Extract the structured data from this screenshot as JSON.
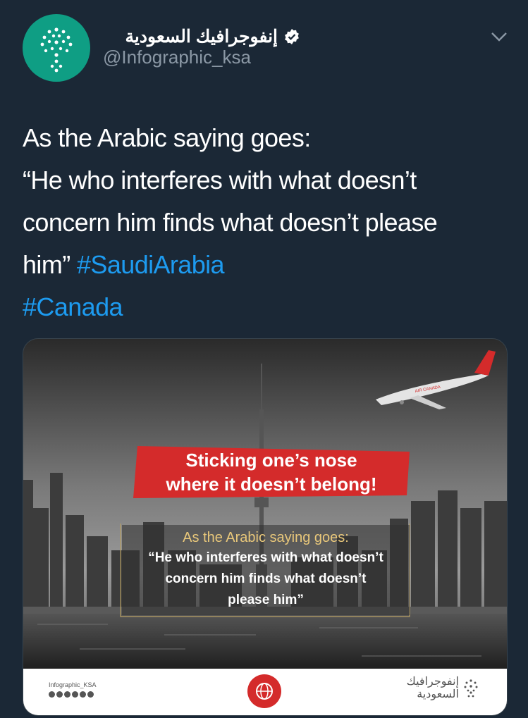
{
  "account": {
    "display_name": "إنفوجرافيك السعودية",
    "handle": "@Infographic_ksa",
    "verified": true,
    "avatar_icon": "infographic-logo-icon",
    "avatar_color": "#0f9e84"
  },
  "menu": {
    "icon": "chevron-down-icon"
  },
  "tweet": {
    "line1": "As the Arabic saying goes:",
    "line2": "“He who interferes with what doesn’t",
    "line3": "concern him finds what doesn’t please",
    "line4_text": "him”",
    "hashtag1": "#SaudiArabia",
    "hashtag2": "#Canada",
    "hashtag_color": "#1d9bf0"
  },
  "media": {
    "banner_line1": "Sticking one’s nose",
    "banner_line2": "where it doesn’t belong!",
    "banner_color": "#d42b2b",
    "quote_lead": "As the Arabic saying goes:",
    "quote_line1": "“He who interferes with what doesn’t",
    "quote_line2": "concern him finds what doesn’t",
    "quote_line3": "please him”",
    "airplane_livery": "AIR CANADA",
    "footer_left": "Infographic_KSA",
    "footer_right_line1": "إنفوجرافيك",
    "footer_right_line2": "السعودية",
    "footer_badge_icon": "globe-hand-icon"
  }
}
